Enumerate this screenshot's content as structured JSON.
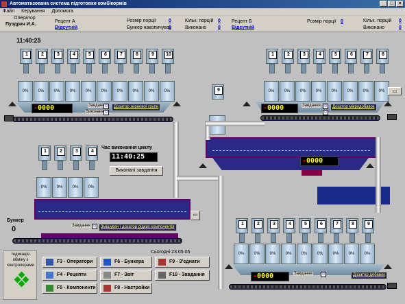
{
  "title": "Автоматизована система підготовки комбікормів",
  "menu": [
    "Файл",
    "Керування",
    "Допомога"
  ],
  "operator": {
    "label": "Оператор",
    "name": "Пуздрач И.А."
  },
  "recipeA": {
    "label": "Рецепт А",
    "value": "Відсутній",
    "portion_size": "Розмір порції",
    "portion_count": "Кільк. порцій",
    "bunker_acc": "Бункер накопичувач",
    "done": "Виконано",
    "v1": "0",
    "v2": "0",
    "v3": "0",
    "v4": "0"
  },
  "recipeB": {
    "label": "Рецепт Б",
    "value": "Відсутній",
    "portion_size": "Розмір порції",
    "portion_count": "Кільк. порцій",
    "done": "Виконано",
    "v1": "0",
    "v2": "0",
    "v3": "0"
  },
  "clock": "11:40:25",
  "cycle_label": "Час виконання циклу",
  "cycle_time": "11:40:25",
  "exec_button": "Виконані завдання",
  "today": "Сьогодні 23.05.05",
  "bunker_label": "Бункер",
  "bunker_value": "0",
  "indication": "Індикація обміну з контролерами",
  "zavdannia": "Завдання",
  "vykonannia": "Виконання",
  "dozers": {
    "grain": "Дозатор зернової групи",
    "micro": "Дозатор мікродобавок",
    "liquid": "Змішувач і дозатор рідких компонентів",
    "additives": "Дозатор добавок"
  },
  "pct": "0%",
  "bin9": "9",
  "fkeys": [
    {
      "label": "F3 - Оператори",
      "icon": "operators-icon",
      "color": "#3355aa"
    },
    {
      "label": "F6 - Бункера",
      "icon": "bunker-icon",
      "color": "#2255cc"
    },
    {
      "label": "F9 - З'єднати",
      "icon": "connect-icon",
      "color": "#aa3333"
    },
    {
      "label": "F4 - Рецепти",
      "icon": "recipes-icon",
      "color": "#4477cc"
    },
    {
      "label": "F7 - Звіт",
      "icon": "report-icon",
      "color": "#888"
    },
    {
      "label": "F10 - Завдання",
      "icon": "tasks-icon",
      "color": "#666"
    },
    {
      "label": "F5 - Компоненти",
      "icon": "components-icon",
      "color": "#338833"
    },
    {
      "label": "F8 - Настройки",
      "icon": "settings-icon",
      "color": "#aa3333"
    }
  ],
  "led1": {
    "sign": "-",
    "digits": "0000"
  },
  "led2": {
    "sign": "-",
    "digits": "0000"
  },
  "led3": {
    "sign": "-",
    "digits": "0000"
  },
  "led4": {
    "sign": "-",
    "digits": "0000"
  },
  "bins_top_left": [
    "1",
    "2",
    "3",
    "4",
    "5",
    "6",
    "7",
    "8",
    "9",
    "10"
  ],
  "bins_top_right": [
    "1",
    "2",
    "3",
    "4",
    "5",
    "6",
    "7",
    "8"
  ],
  "bins_mid_left": [
    "1",
    "2",
    "3",
    "4"
  ],
  "bins_bottom_right": [
    "1",
    "2",
    "3",
    "4",
    "5",
    "6",
    "7",
    "8",
    "9"
  ],
  "colors": {
    "hopper": "#2a2a86",
    "titlebar": "#0a246a"
  }
}
